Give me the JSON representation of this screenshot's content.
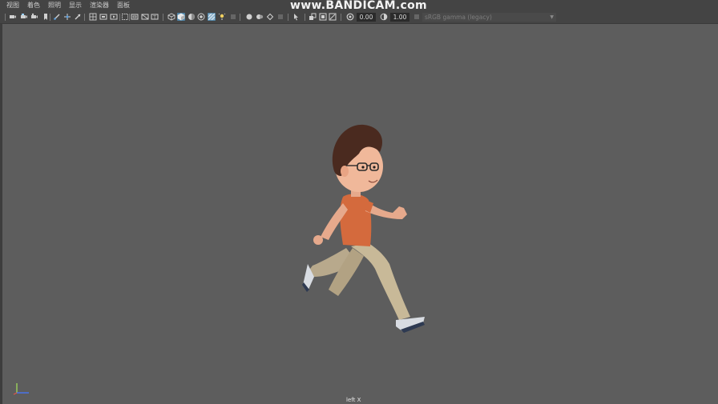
{
  "menu": {
    "items": [
      "视图",
      "着色",
      "照明",
      "显示",
      "渲染器",
      "面板"
    ]
  },
  "watermark": "www.BANDICAM.com",
  "toolbar": {
    "exposure_value": "0.00",
    "gamma_value": "1.00",
    "color_space": "sRGB gamma (legacy)",
    "icons": [
      "select-camera-icon",
      "camera-attributes-icon",
      "bookmark-icon",
      "image-plane-icon",
      "grease-pencil-icon",
      "pivot-icon",
      "2d-pan-zoom-icon",
      "grid-icon",
      "film-gate-icon",
      "resolution-gate-icon",
      "gate-mask-icon",
      "field-chart-icon",
      "safe-action-icon",
      "safe-title-icon",
      "wireframe-icon",
      "smooth-shade-icon",
      "default-material-icon",
      "textured-icon",
      "use-lights-icon",
      "shadows-icon",
      "screen-space-ao-icon",
      "motion-blur-icon",
      "anti-aliasing-icon",
      "depth-of-field-icon",
      "isolate-select-icon",
      "xray-icon",
      "xray-joints-icon",
      "xray-components-icon",
      "exposure-icon",
      "gamma-icon",
      "view-transform-icon"
    ],
    "colors": {
      "toolbar_bg": "#444444",
      "active_icon_bg": "#5285a6",
      "viewport_bg": "#5d5d5d"
    }
  },
  "viewport": {
    "camera_label": "left X"
  }
}
